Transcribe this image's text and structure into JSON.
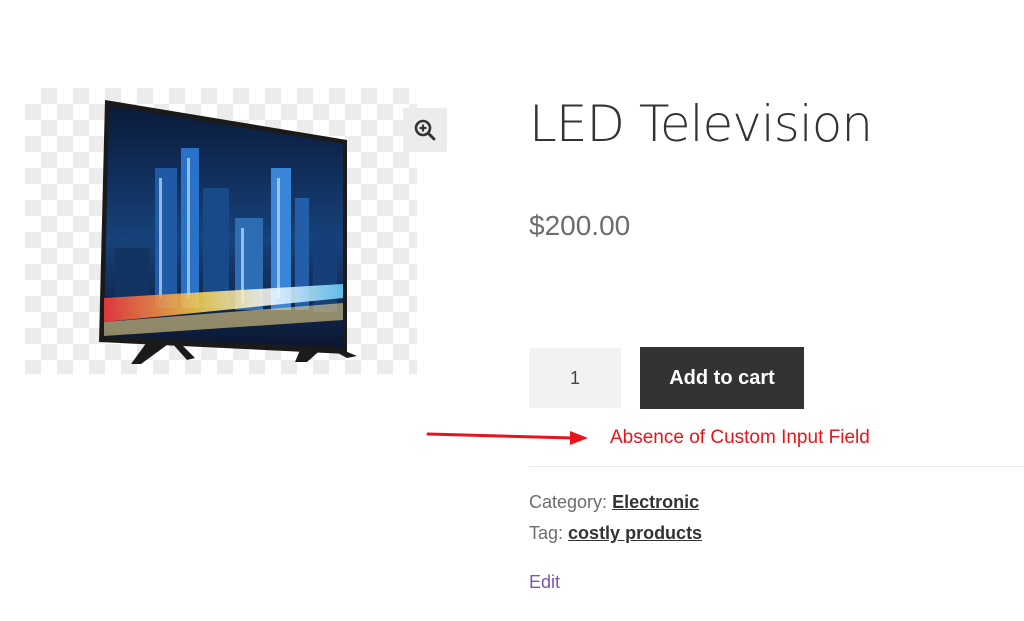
{
  "product": {
    "title": "LED Television",
    "price": "$200.00",
    "image_alt": "LED television showing a city skyline at night"
  },
  "cart_form": {
    "quantity": "1",
    "add_to_cart_label": "Add to cart"
  },
  "annotation": {
    "text": "Absence of Custom Input Field",
    "color": "#e8141b"
  },
  "meta": {
    "category_label": "Category:",
    "category_value": "Electronic",
    "tag_label": "Tag:",
    "tag_value": "costly products"
  },
  "edit_label": "Edit",
  "icons": {
    "zoom": "zoom-in-icon"
  },
  "colors": {
    "button_bg": "#333333",
    "link_purple": "#7f54b3"
  }
}
